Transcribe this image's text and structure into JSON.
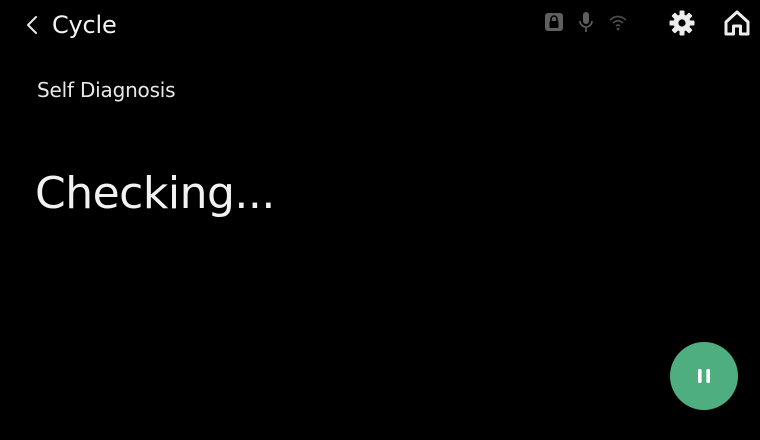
{
  "header": {
    "back_label": "Cycle",
    "icons": {
      "back": "chevron-left-icon",
      "lock": "lock-icon",
      "mic": "microphone-icon",
      "wifi": "wifi-icon",
      "settings": "gear-icon",
      "home": "home-icon"
    }
  },
  "main": {
    "subtitle": "Self Diagnosis",
    "status": "Checking..."
  },
  "controls": {
    "pause_icon": "pause-icon",
    "pause_color": "#4fae7f"
  },
  "colors": {
    "background": "#000000",
    "text": "#f2f2f2",
    "status_icons": "#6b6b6b"
  }
}
